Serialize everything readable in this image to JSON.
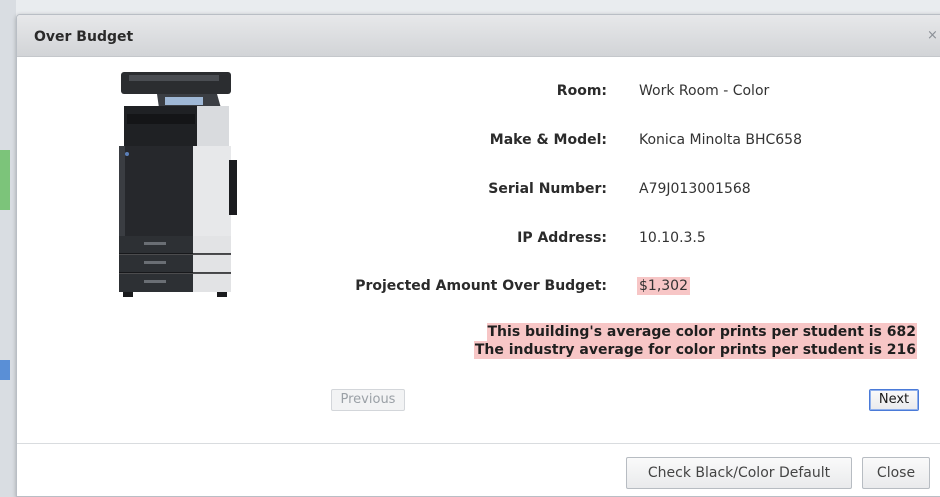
{
  "dialog": {
    "title": "Over Budget",
    "close_glyph": "×"
  },
  "device": {
    "image_icon": "copier-printer-image",
    "fields": [
      {
        "label": "Room:",
        "value": "Work Room - Color"
      },
      {
        "label": "Make & Model:",
        "value": "Konica Minolta BHC658"
      },
      {
        "label": "Serial Number:",
        "value": "A79J013001568"
      },
      {
        "label": "IP Address:",
        "value": "10.10.3.5"
      },
      {
        "label": "Projected Amount Over Budget:",
        "value": "$1,302"
      }
    ]
  },
  "notices": {
    "building_average": "This building's average color prints per student is 682",
    "industry_average": "The industry average for color prints per student is 216"
  },
  "nav": {
    "previous_label": "Previous",
    "next_label": "Next"
  },
  "footer": {
    "check_default_label": "Check Black/Color Default",
    "close_label": "Close"
  },
  "colors": {
    "highlight": "#f7c6c6",
    "focus_border": "#4a7ad8"
  }
}
